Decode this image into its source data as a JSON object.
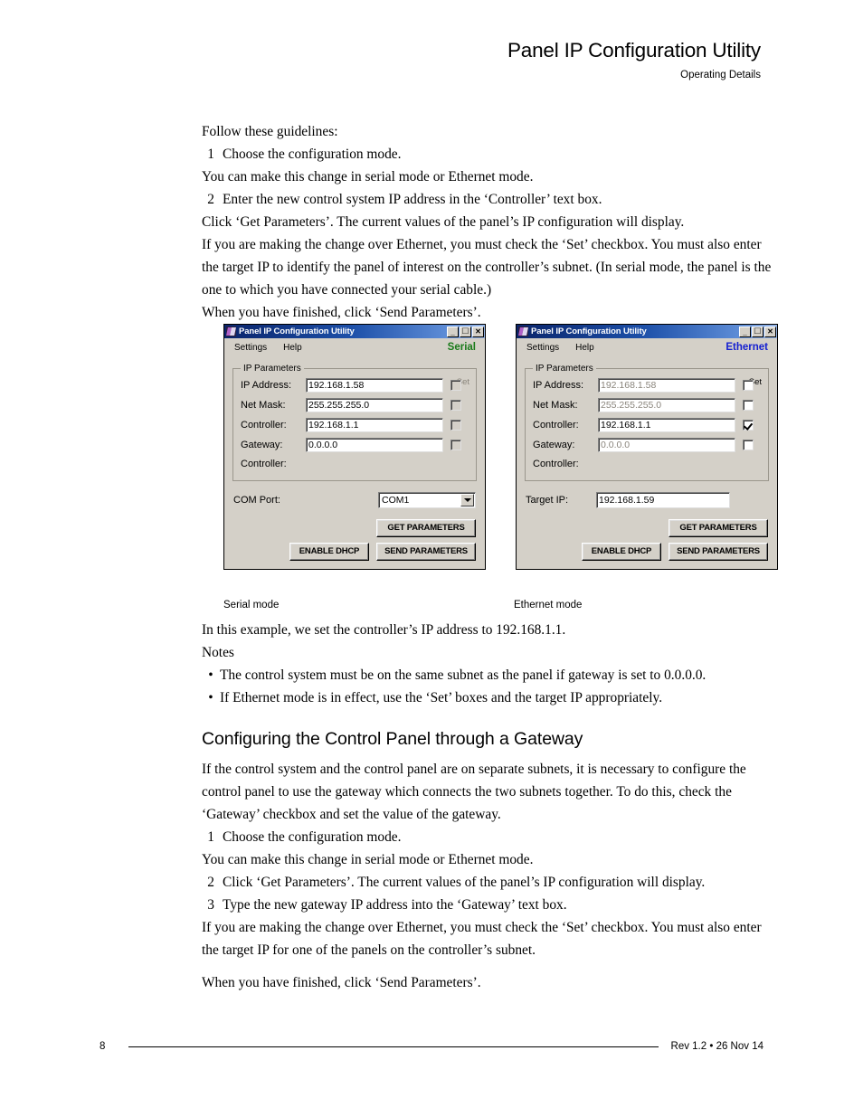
{
  "header": {
    "title": "Panel IP Configuration Utility",
    "subtitle": "Operating Details"
  },
  "intro": {
    "lead": "Follow these guidelines:",
    "step1_num": "1",
    "step1_text": "Choose the configuration mode.",
    "step1_sub": "You can make this change in serial mode or Ethernet mode.",
    "step2_num": "2",
    "step2_text": "Enter the new control system IP address in the ‘Controller’ text box.",
    "step2_sub1": "Click ‘Get Parameters’. The current values of the panel’s IP configuration will display.",
    "step2_sub2": "If you are making the change over Ethernet, you must check the ‘Set’ checkbox. You must also enter the target IP to identify the panel of interest on the controller’s subnet. (In serial mode, the panel is the one to which you have connected your serial cable.)",
    "step2_sub3": "When you have finished, click ‘Send Parameters’."
  },
  "dialog_serial": {
    "titlebar": {
      "title": "Panel IP Configuration Utility",
      "minimize": "_",
      "maximize": "□",
      "close": "✕"
    },
    "menu": {
      "settings": "Settings",
      "help": "Help"
    },
    "mode": "Serial",
    "mode_color": "#1a7a1a",
    "group_legend": "IP Parameters",
    "set_header": "Set",
    "fields": [
      {
        "label": "IP Address:",
        "value": "192.168.1.58",
        "checked": false
      },
      {
        "label": "Net Mask:",
        "value": "255.255.255.0",
        "checked": false
      },
      {
        "label": "Controller:",
        "value": "192.168.1.1",
        "checked": false
      },
      {
        "label": "Gateway:",
        "value": "0.0.0.0",
        "checked": false
      }
    ],
    "status_label": "Controller:",
    "status_value": "",
    "com_label": "COM Port:",
    "com_value": "COM1",
    "buttons": {
      "get": "GET PARAMETERS",
      "dhcp": "ENABLE DHCP",
      "send": "SEND PARAMETERS"
    },
    "caption": "Serial mode"
  },
  "dialog_ethernet": {
    "titlebar": {
      "title": "Panel IP Configuration Utility",
      "minimize": "_",
      "maximize": "□",
      "close": "✕"
    },
    "menu": {
      "settings": "Settings",
      "help": "Help"
    },
    "mode": "Ethernet",
    "mode_color": "#1520d0",
    "group_legend": "IP Parameters",
    "set_header": "Set",
    "fields": [
      {
        "label": "IP Address:",
        "value": "192.168.1.58",
        "checked": false
      },
      {
        "label": "Net Mask:",
        "value": "255.255.255.0",
        "checked": false
      },
      {
        "label": "Controller:",
        "value": "192.168.1.1",
        "checked": true
      },
      {
        "label": "Gateway:",
        "value": "0.0.0.0",
        "checked": false
      }
    ],
    "status_label": "Controller:",
    "status_value": "",
    "target_label": "Target IP:",
    "target_value": "192.168.1.59",
    "buttons": {
      "get": "GET PARAMETERS",
      "dhcp": "ENABLE DHCP",
      "send": "SEND PARAMETERS"
    },
    "caption": "Ethernet mode"
  },
  "after_figure": {
    "example": "In this example, we set the controller’s IP address to 192.168.1.1.",
    "notes_title": "Notes",
    "note1": "The control system must be on the same subnet as the panel if gateway is set to 0.0.0.0.",
    "note2": "If Ethernet mode is in effect, use the ‘Set’ boxes and the target IP appropriately.",
    "bullet": "•"
  },
  "gateway_section": {
    "heading": "Configuring the Control Panel through a Gateway",
    "intro": "If the control system and the control panel are on separate subnets, it is necessary to configure the control panel to use the gateway which connects the two subnets together. To do this, check the ‘Gateway’ checkbox and set the value of the gateway.",
    "step1_num": "1",
    "step1_text": "Choose the configuration mode.",
    "step1_sub": "You can make this change in serial mode or Ethernet mode.",
    "step2_num": "2",
    "step2_text": "Click ‘Get Parameters’. The current values of the panel’s IP configuration will display.",
    "step3_num": "3",
    "step3_text": "Type the new gateway IP address into the ‘Gateway’ text box.",
    "step3_sub": "If you are making the change over Ethernet, you must check the ‘Set’ checkbox. You must also enter the target IP for one of the panels on the controller’s subnet.",
    "closing": "When you have finished, click ‘Send Parameters’."
  },
  "footer": {
    "page_number": "8",
    "revision": "Rev 1.2 • 26 Nov 14"
  }
}
